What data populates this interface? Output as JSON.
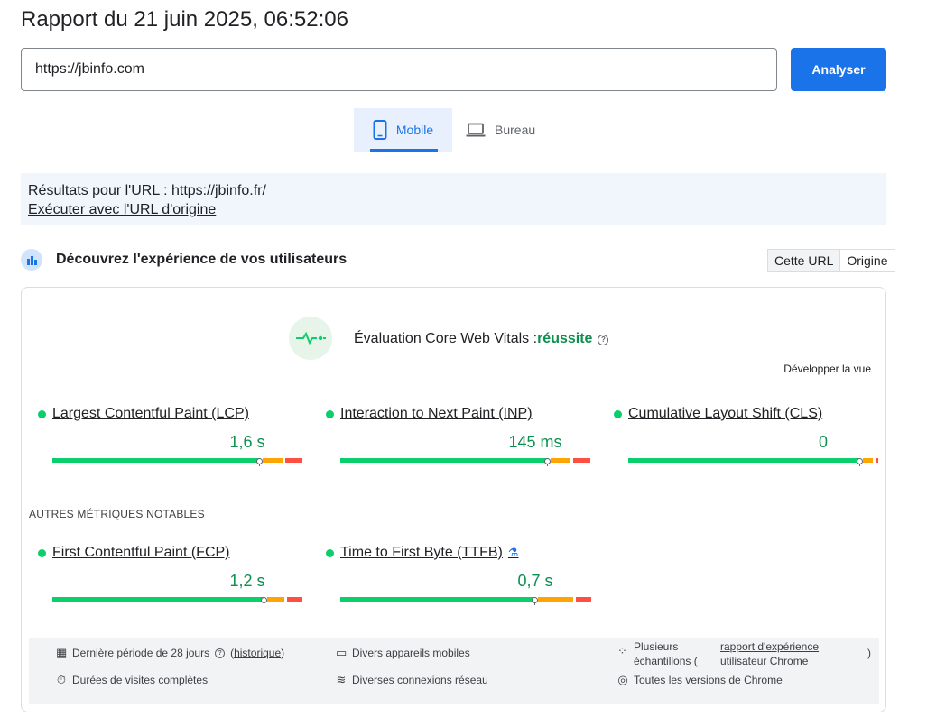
{
  "header": {
    "title": "Rapport du 21 juin 2025, 06:52:06"
  },
  "search": {
    "value": "https://jbinfo.com",
    "button_label": "Analyser"
  },
  "tabs": [
    {
      "label": "Mobile",
      "icon": "smartphone-icon",
      "selected": true
    },
    {
      "label": "Bureau",
      "icon": "laptop-icon",
      "selected": false
    }
  ],
  "banner": {
    "results_text": "Résultats pour l'URL : https://jbinfo.fr/",
    "link_text": "Exécuter avec l'URL d'origine"
  },
  "section": {
    "title": "Découvrez l'expérience de vos utilisateurs",
    "toggle": [
      "Cette URL",
      "Origine"
    ],
    "toggle_selected": "Cette URL"
  },
  "cwv": {
    "label": "Évaluation Core Web Vitals :",
    "status": "réussite",
    "expand": "Développer la vue"
  },
  "metrics": [
    {
      "name": "Largest Contentful Paint (LCP)",
      "value": "1,6 s",
      "status": "good",
      "distribution": [
        0.84,
        0.09,
        0.07
      ]
    },
    {
      "name": "Interaction to Next Paint (INP)",
      "value": "145 ms",
      "status": "good",
      "distribution": [
        0.84,
        0.09,
        0.07
      ]
    },
    {
      "name": "Cumulative Layout Shift (CLS)",
      "value": "0",
      "status": "good",
      "distribution": [
        0.94,
        0.05,
        0.01
      ]
    }
  ],
  "other_title": "AUTRES MÉTRIQUES NOTABLES",
  "other_metrics": [
    {
      "name": "First Contentful Paint (FCP)",
      "value": "1,2 s",
      "status": "good",
      "distribution": [
        0.86,
        0.08,
        0.06
      ]
    },
    {
      "name": "Time to First Byte (TTFB)",
      "value": "0,7 s",
      "status": "good",
      "experimental": true,
      "distribution": [
        0.79,
        0.15,
        0.06
      ]
    }
  ],
  "footer": {
    "period_prefix": "Dernière période de 28 jours",
    "history_link": "historique",
    "devices": "Divers appareils mobiles",
    "samples_prefix": "Plusieurs échantillons (",
    "samples_link": "rapport d'expérience utilisateur Chrome",
    "samples_suffix": ")",
    "visits": "Durées de visites complètes",
    "network": "Diverses connexions réseau",
    "chrome": "Toutes les versions de Chrome"
  },
  "colors": {
    "accent": "#1a73e8",
    "good": "#0cce6b",
    "good_text": "#0d904f",
    "average": "#ffa400",
    "poor": "#ff4e42"
  }
}
